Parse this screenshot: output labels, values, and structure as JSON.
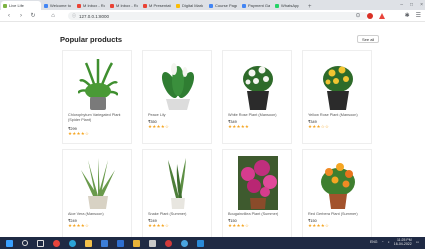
{
  "browser": {
    "tabs": [
      {
        "label": "Live Life",
        "color": "#7cb342",
        "active": true
      },
      {
        "label": "Welcome to",
        "color": "#4285f4"
      },
      {
        "label": "M Inbox - Rohit",
        "color": "#ea4335"
      },
      {
        "label": "M Inbox - Rohit",
        "color": "#ea4335"
      },
      {
        "label": "M Presentation",
        "color": "#ea4335"
      },
      {
        "label": "Digital Mark",
        "color": "#fbbc05"
      },
      {
        "label": "Course Page",
        "color": "#4285f4"
      },
      {
        "label": "Payment Gate",
        "color": "#4285f4"
      },
      {
        "label": "WhatsApp",
        "color": "#25d366"
      }
    ],
    "new_tab": "+",
    "url": "127.0.0.1:8000",
    "minimize": "–",
    "maximize": "□",
    "close": "×"
  },
  "page": {
    "heading": "Popular products",
    "see_all": "See all",
    "products": [
      {
        "name": "Chlorophytum Variegated Plant (Spider Plant)",
        "price": "₹299",
        "stars": "★★★★☆"
      },
      {
        "name": "Peace Lily",
        "price": "₹350",
        "stars": "★★★★☆"
      },
      {
        "name": "White Rose Plant (Mansoon)",
        "price": "₹349",
        "stars": "★★★★★"
      },
      {
        "name": "Yellow Rose Plant (Mansoon)",
        "price": "₹349",
        "stars": "★★★☆☆"
      },
      {
        "name": "Aloe Vera (Mansoon)",
        "price": "₹249",
        "stars": "★★★★☆"
      },
      {
        "name": "Snake Plant (Summer)",
        "price": "₹249",
        "stars": "★★★★☆"
      },
      {
        "name": "Bougainvillea Plant (Summer)",
        "price": "₹150",
        "stars": "★★★★☆"
      },
      {
        "name": "Red Gerbera Plant (Summer)",
        "price": "₹150",
        "stars": "★★★★☆"
      }
    ]
  },
  "taskbar": {
    "lang": "ENG",
    "time": "11:25 PM",
    "date": "16-04-2022"
  }
}
